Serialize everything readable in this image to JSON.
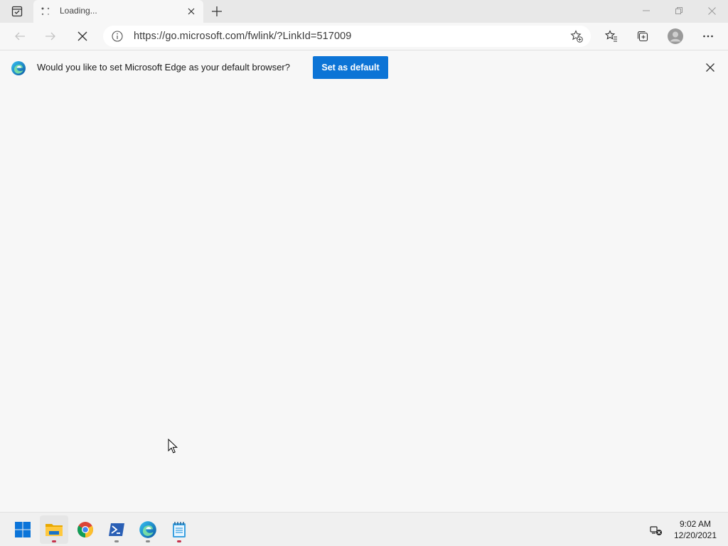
{
  "tab": {
    "title": "Loading...",
    "spinner_icon": "loading-spinner-icon"
  },
  "address_bar": {
    "url": "https://go.microsoft.com/fwlink/?LinkId=517009"
  },
  "infobar": {
    "message": "Would you like to set Microsoft Edge as your default browser?",
    "button_label": "Set as default"
  },
  "taskbar": {
    "apps": [
      {
        "name": "start",
        "icon": "windows-start-icon"
      },
      {
        "name": "file-explorer",
        "icon": "folder-icon",
        "running": true
      },
      {
        "name": "chrome",
        "icon": "chrome-icon"
      },
      {
        "name": "powershell",
        "icon": "powershell-icon",
        "running": true
      },
      {
        "name": "edge",
        "icon": "edge-icon",
        "running": true
      },
      {
        "name": "notepad",
        "icon": "notepad-icon",
        "running": true
      }
    ],
    "time": "9:02 AM",
    "date": "12/20/2021"
  },
  "colors": {
    "accent": "#0c74d6",
    "page_bg": "#f7f7f7",
    "tabbar_bg": "#e8e8e8"
  }
}
